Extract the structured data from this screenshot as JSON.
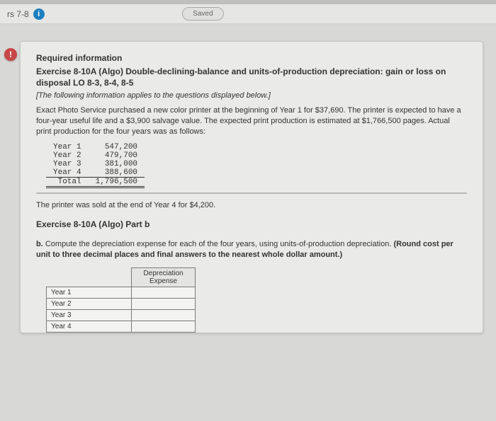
{
  "nav": {
    "left_label": "rs 7-8",
    "info_glyph": "i",
    "saved_label": "Saved"
  },
  "alert_glyph": "!",
  "req_info_label": "Required information",
  "exercise_title": "Exercise 8-10A (Algo) Double-declining-balance and units-of-production depreciation: gain or loss on disposal LO 8-3, 8-4, 8-5",
  "applies_note": "[The following information applies to the questions displayed below.]",
  "paragraph": "Exact Photo Service purchased a new color printer at the beginning of Year 1 for $37,690. The printer is expected to have a four-year useful life and a $3,900 salvage value. The expected print production is estimated at $1,766,500 pages. Actual print production for the four years was as follows:",
  "production": {
    "rows": [
      {
        "label": "Year 1",
        "value": "547,200"
      },
      {
        "label": "Year 2",
        "value": "479,700"
      },
      {
        "label": "Year 3",
        "value": "381,000"
      },
      {
        "label": "Year 4",
        "value": "388,600"
      }
    ],
    "total_label": "Total",
    "total_value": "1,796,500"
  },
  "sold_line": "The printer was sold at the end of Year 4 for $4,200.",
  "partb_head": "Exercise 8-10A (Algo) Part b",
  "partb_instr_lead": "b. ",
  "partb_instr_body": "Compute the depreciation expense for each of the four years, using units-of-production depreciation. ",
  "partb_hint": "(Round cost per unit to three decimal places and final answers to the nearest whole dollar amount.)",
  "dep_table": {
    "header": "Depreciation\nExpense",
    "rows": [
      "Year 1",
      "Year 2",
      "Year 3",
      "Year 4"
    ]
  }
}
